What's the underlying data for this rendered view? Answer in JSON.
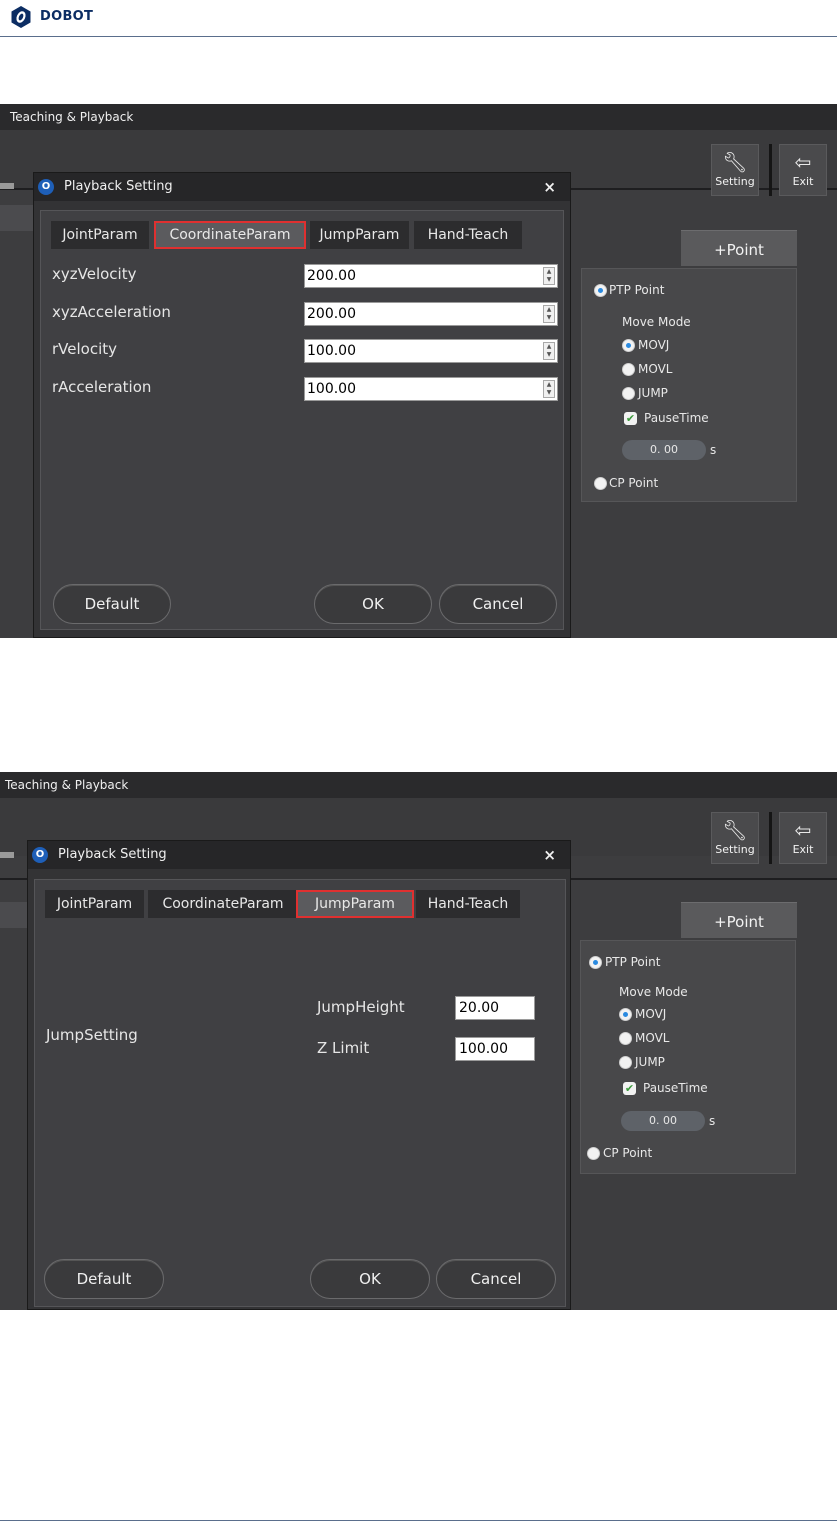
{
  "brand": {
    "name": "DOBOT"
  },
  "window": {
    "title": "Teaching & Playback"
  },
  "toolbar": {
    "setting_label": "Setting",
    "exit_label": "Exit",
    "setting_icon": "wrench-icon",
    "exit_icon": "exit-icon"
  },
  "side_panel": {
    "add_point_label": "+Point",
    "ptp_label": "PTP Point",
    "move_mode_label": "Move Mode",
    "modes": [
      "MOVJ",
      "MOVL",
      "JUMP"
    ],
    "selected_mode": "MOVJ",
    "pause_time_label": "PauseTime",
    "pause_time_checked": true,
    "pause_time_value": "0. 00",
    "pause_time_unit": "s",
    "cp_label": "CP Point",
    "selected_point_type": "PTP Point"
  },
  "dialog": {
    "title": "Playback Setting",
    "close_symbol": "×",
    "tabs": [
      "JointParam",
      "CoordinateParam",
      "JumpParam",
      "Hand-Teach"
    ],
    "buttons": {
      "default": "Default",
      "ok": "OK",
      "cancel": "Cancel"
    }
  },
  "coordinate_view": {
    "active_tab": "CoordinateParam",
    "fields": [
      {
        "label": "xyzVelocity",
        "value": "200.00"
      },
      {
        "label": "xyzAcceleration",
        "value": "200.00"
      },
      {
        "label": "rVelocity",
        "value": "100.00"
      },
      {
        "label": "rAcceleration",
        "value": "100.00"
      }
    ]
  },
  "jump_view": {
    "active_tab": "JumpParam",
    "group_label": "JumpSetting",
    "jump_height_label": "JumpHeight",
    "jump_height_value": "20.00",
    "z_limit_label": "Z Limit",
    "z_limit_value": "100.00"
  },
  "colors": {
    "highlight": "#e03030",
    "radio_dot": "#2a8ae0",
    "brand": "#0c2d63"
  }
}
